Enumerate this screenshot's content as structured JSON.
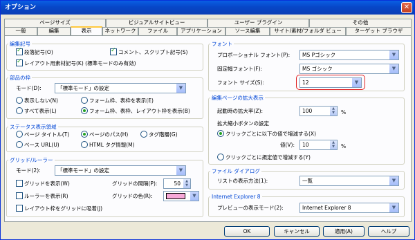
{
  "window": {
    "title": "オプション"
  },
  "tabs_row1": [
    "ページサイズ",
    "ビジュアルサイトビュー",
    "ユーザー プラグイン",
    "その他"
  ],
  "tabs_row2": [
    "一般",
    "編集",
    "表示",
    "ネットワーク",
    "ファイル",
    "アプリケーション",
    "ソース編集",
    "サイト/素材/フォルダ ビュー",
    "ターゲット ブラウザ"
  ],
  "active_tab": "表示",
  "edit_marks": {
    "legend": "編集記号",
    "paragraph_mark": {
      "label": "段落記号(O)",
      "checked": true
    },
    "comment_script_mark": {
      "label": "コメント、スクリプト記号(S)",
      "checked": true
    },
    "layout_marks": {
      "label": "レイアウト用素材記号(K) (標準モードのみ有効)",
      "checked": true
    }
  },
  "frame": {
    "legend": "部品の枠",
    "mode_label": "モード(D):",
    "mode_value": "「標準モード」の設定",
    "no_display": "表示しない(N)",
    "form_table_display": "フォーム枠、表枠を表示(E)",
    "show_all": "すべて表示(L)",
    "form_table_layout": "フォーム枠、表枠、レイアウト枠を表示(B)",
    "selected": "form_table_layout"
  },
  "status_display": {
    "legend": "ステータス表示領域",
    "page_title": "ページ タイトル(T)",
    "page_path": "ページのパス(H)",
    "tag_hierarchy": "タグ階層(G)",
    "base_url": "ベース URL(U)",
    "html_tag_info": "HTML タグ情報(M)",
    "selected": "page_path"
  },
  "grid": {
    "legend": "グリッド/ルーラー",
    "mode_label": "モード(2):",
    "mode_value": "「標準モード」の設定",
    "show_grid": {
      "label": "グリッドを表示(W)",
      "checked": false
    },
    "grid_spacing_label": "グリッドの間隔(P):",
    "grid_spacing_value": "50",
    "show_ruler": {
      "label": "ルーラーを表示(R)",
      "checked": false
    },
    "grid_color_label": "グリッドの色(R):",
    "grid_color": "#f7a8d8",
    "snap_grid": {
      "label": "レイアウト枠をグリッドに吸着(J)",
      "checked": false
    }
  },
  "font": {
    "legend": "フォント",
    "proportional_label": "プロポーショナル フォント(P):",
    "proportional_value": "MS Pゴシック",
    "fixed_label": "固定幅フォント(F):",
    "fixed_value": "MS ゴシック",
    "size_label": "フォント サイズ(S):",
    "size_value": "12"
  },
  "zoom": {
    "legend": "編集ページの拡大表示",
    "startup_label": "起動時の拡大率(Z):",
    "startup_value": "100",
    "percent": "%",
    "button_setting_label": "拡大縮小ボタンの設定",
    "increment_option": "クリックごとに以下の値で増減する(X)",
    "value_label": "値(V):",
    "value": "10",
    "preset_option": "クリックごとに規定値で増減する(Y)",
    "selected": "increment"
  },
  "file_dialog": {
    "legend": "ファイル ダイアログ",
    "list_mode_label": "リストの表示方法(1):",
    "list_mode_value": "一覧"
  },
  "ie8": {
    "legend": "Internet Explorer 8",
    "preview_label": "プレビューの表示モード(2):",
    "preview_value": "Internet Explorer 8"
  },
  "buttons": {
    "ok": "OK",
    "cancel": "キャンセル",
    "apply": "適用(A)",
    "help": "ヘルプ"
  }
}
